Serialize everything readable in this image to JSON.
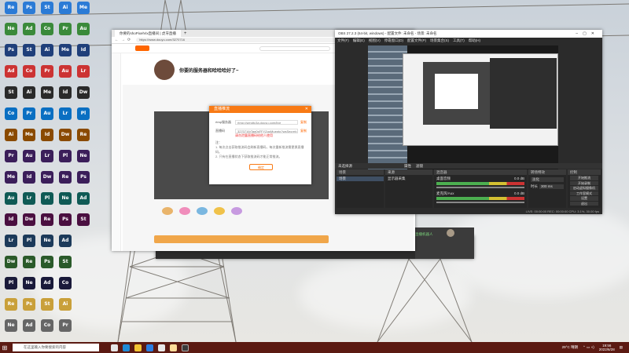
{
  "browser": {
    "tab_title": "你要的shoPixelVix直播间 | 虎牙直播",
    "url": "https://www.douyu.com/3270716",
    "room_title": "你要的服务器和哈哈哈好了~",
    "popup": {
      "title": "直播推流",
      "label_server": "rtmp服务器",
      "server_value": "rtmp://sendtc3a.douyu.com/live",
      "label_key": "直播码",
      "key_value": "3270716rTag0sFFYZqoMuepto?wsSecret=...",
      "copy1": "复制",
      "copy2": "复制",
      "warn": "请勿泄露直播码给他人使用",
      "note_title": "注：",
      "note1": "1. 每次点击获取推流码会刷新直播码，每次重新推流需更换直播码。",
      "note2": "2. 只有在直播状态下获取推流码才能正常推流。",
      "confirm": "确定"
    }
  },
  "obs": {
    "title": "OBS 27.2.3 (64-bit, windows) - 配置文件: 未命名 - 场景: 未命名",
    "menu": [
      "文件(F)",
      "编辑(E)",
      "视图(V)",
      "停靠窗口(D)",
      "配置文件(P)",
      "场景集合(S)",
      "工具(T)",
      "帮助(H)"
    ],
    "no_source": "未选择源",
    "props": "属性",
    "filters": "滤镜",
    "panels": [
      "场景",
      "来源",
      "混音器",
      "转场特效",
      "控制"
    ],
    "scene_item": "场景",
    "source_item": "显示器采集",
    "mixer": [
      {
        "name": "桌面音频",
        "db": "0.0 dB"
      },
      {
        "name": "麦克风/Aux",
        "db": "0.0 dB"
      }
    ],
    "transition": "淡化",
    "duration_label": "时长",
    "duration": "300 ms",
    "controls": [
      "开始推流",
      "开始录制",
      "启动虚拟摄像机",
      "工作室模式",
      "设置",
      "退出"
    ],
    "status": "LIVE: 00:00:00   REC: 00:00:00   CPU: 3.1%, 30.00 fps"
  },
  "chat": {
    "user": "直播机器人"
  },
  "taskbar": {
    "search_placeholder": "在这里输入你要搜索的内容",
    "weather": "29°C 晴朗",
    "time": "19:56",
    "date": "2022/6/28"
  },
  "icons": [
    "Recycle",
    "Nei",
    "Ps",
    "Adobe",
    "Steam",
    "Code",
    "Ai",
    "Pr",
    "Me",
    "Au",
    "Id",
    "Lrc",
    "Dw",
    "Pl"
  ]
}
